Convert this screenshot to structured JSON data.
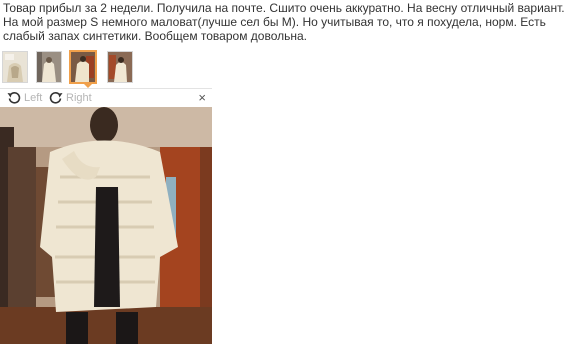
{
  "review": {
    "text": "Товар прибыл за 2 недели. Получила на почте. Сшито очень аккуратно. На весну отличный вариант. На мой размер S немного маловат(лучше сел бы М). Но учитывая то, что я похудела, норм. Есть слабый запах синтетики. Вообщем товаром довольна."
  },
  "thumbnails": [
    {
      "icon": "photo-thumbnail-1"
    },
    {
      "icon": "photo-thumbnail-2"
    },
    {
      "icon": "photo-thumbnail-3",
      "active": true
    },
    {
      "icon": "photo-thumbnail-4"
    }
  ],
  "viewer": {
    "rotate_left_label": "Left",
    "rotate_right_label": "Right",
    "close_label": "×",
    "accent_color": "#f0a04b"
  }
}
